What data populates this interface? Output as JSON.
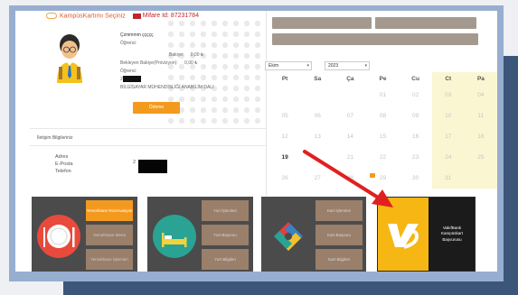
{
  "header": {
    "card_select": "KampüsKartımı Seçiniz",
    "mifare": "Mifare Id:  87231784"
  },
  "profile": {
    "name_line": "Çzmmmm ççççç",
    "role": "Öğrenci",
    "bakiye_label": "Bakiye:",
    "bakiye_value": "0,00 ₺",
    "bekleyen_label": "Bekleyen Bakiye(Provizyon):",
    "bekleyen_value": "0,00 ₺",
    "role2": "Öğrenci",
    "id_prefix": "2",
    "department": "BİLGİSAYAR MÜHENDİSLİĞİ ANABİLİM DALI",
    "pay_button": "Ödeme"
  },
  "contact": {
    "title": "İletişim Bilgileriniz",
    "address_label": "Adres",
    "email_label": "E-Posta",
    "phone_label": "Telefon",
    "value_prefix": "2"
  },
  "tiles": [
    {
      "icon": "plate-icon",
      "color": "#e53e3e",
      "items": [
        "Yemekhane Rezervasyon",
        "Yemekhane Menü",
        "Yemekhane İşlemleri"
      ]
    },
    {
      "icon": "bed-icon",
      "color": "#2a9d8f",
      "items": [
        "Yurt İşlemleri",
        "Yurt Başvuru",
        "Yurt Bilgileri"
      ]
    },
    {
      "icon": "logo-icon",
      "color": "#2b6cb0",
      "items": [
        "Kart İşlemleri",
        "Kart Başvuru",
        "Kart Bilgileri"
      ]
    }
  ],
  "calendar": {
    "month": "Ekim",
    "year": "2023",
    "days": [
      "Pt",
      "Sa",
      "Ça",
      "Pe",
      "Cu",
      "Ct",
      "Pa"
    ],
    "weeks": [
      [
        "",
        "",
        "",
        "01",
        "02",
        "03",
        "04"
      ],
      [
        "05",
        "06",
        "07",
        "08",
        "09",
        "10",
        "11"
      ],
      [
        "12",
        "13",
        "14",
        "15",
        "16",
        "17",
        "18"
      ],
      [
        "19",
        "",
        "21",
        "22",
        "23",
        "24",
        "25"
      ],
      [
        "26",
        "27",
        "28",
        "29",
        "30",
        "31",
        ""
      ]
    ],
    "current_day": "19"
  },
  "vakif": {
    "line1": "VakıfBank",
    "line2": "Kampüskart",
    "line3": "Başvurusu"
  },
  "colors": {
    "accent": "#f39a1e",
    "frame": "#98aed0",
    "band": "#3b5679",
    "arrow": "#e02020",
    "tile_bg": "#4b4b4b",
    "tile_orange": "#f39a1e",
    "vakif_yellow": "#f6b613"
  }
}
